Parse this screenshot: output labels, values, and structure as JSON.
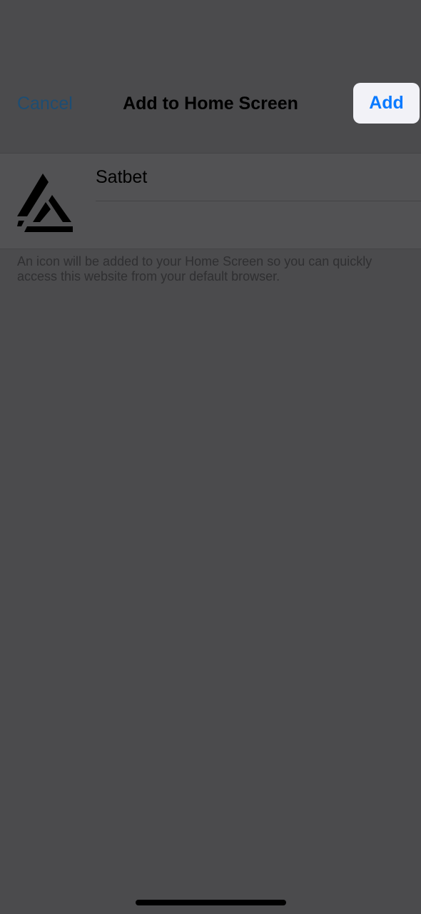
{
  "nav": {
    "cancel_label": "Cancel",
    "title": "Add to Home Screen",
    "add_label": "Add"
  },
  "shortcut": {
    "icon": "satbet-logo-icon",
    "name_value": "Satbet",
    "url_value": ""
  },
  "helper": {
    "text": "An icon will be added to your Home Screen so you can quickly access this website from your default browser."
  },
  "colors": {
    "background": "#4b4b4d",
    "card": "#525254",
    "accent": "#0a7aff",
    "cancel": "#1d4d73"
  }
}
